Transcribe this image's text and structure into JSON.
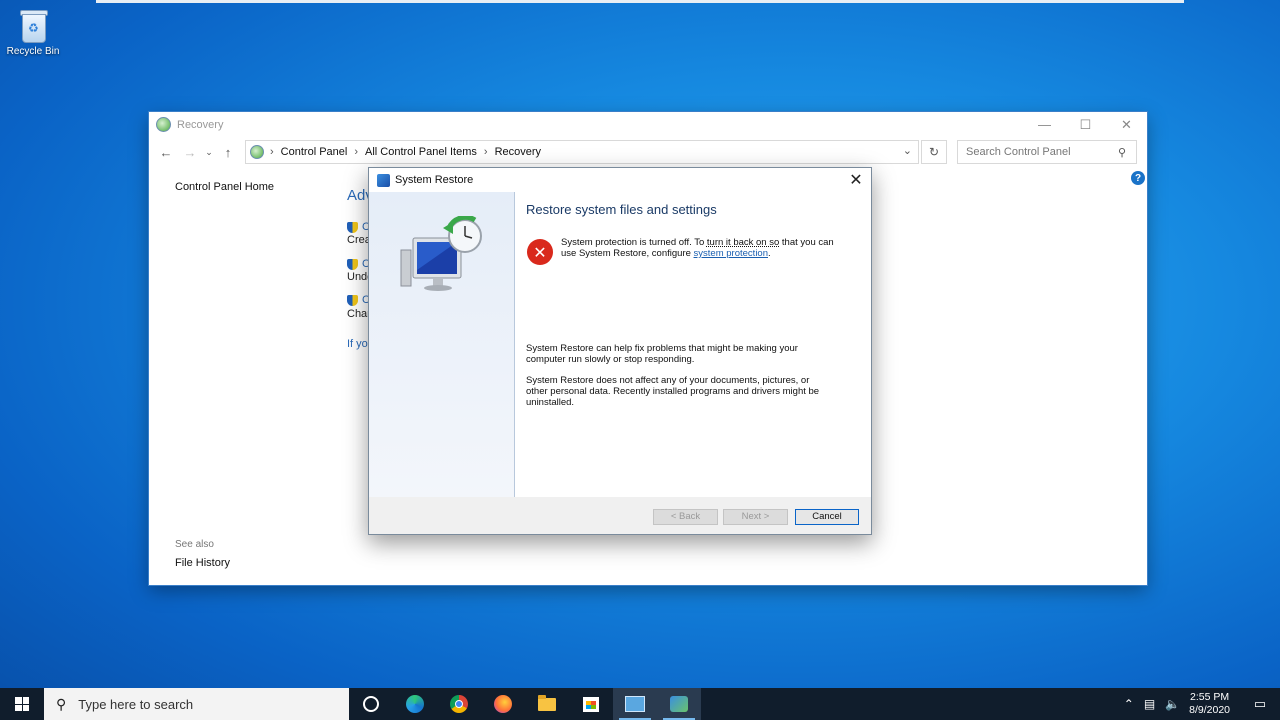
{
  "desktop": {
    "recycle_bin_label": "Recycle Bin"
  },
  "control_panel": {
    "title": "Recovery",
    "breadcrumb": [
      "Control Panel",
      "All Control Panel Items",
      "Recovery"
    ],
    "search_placeholder": "Search Control Panel",
    "left_nav": {
      "home": "Control Panel Home",
      "see_also": "See also",
      "file_history": "File History"
    },
    "obscured": {
      "heading": "Adv",
      "link1": "C",
      "desc1": "Crea",
      "link2": "C",
      "desc2": "Undo",
      "link3": "C",
      "desc3": "Chan",
      "footer": "If yo"
    }
  },
  "system_restore": {
    "title": "System Restore",
    "heading": "Restore system files and settings",
    "error_pre": "System protection is turned off. To ",
    "error_dotted": "turn it back on so",
    "error_mid": " that you can use System Restore, configure ",
    "error_link": "system protection",
    "error_post": ".",
    "para1": "System Restore can help fix problems that might be making your computer run slowly or stop responding.",
    "para2": "System Restore does not affect any of your documents, pictures, or other personal data. Recently installed programs and drivers might be uninstalled.",
    "buttons": {
      "back": "< Back",
      "next": "Next >",
      "cancel": "Cancel"
    }
  },
  "taskbar": {
    "search_placeholder": "Type here to search",
    "time": "2:55 PM",
    "date": "8/9/2020",
    "apps": [
      "cortana-icon",
      "edge-icon",
      "chrome-icon",
      "firefox-icon",
      "file-explorer-icon",
      "store-icon",
      "control-panel-icon",
      "system-restore-icon"
    ]
  },
  "colors": {
    "desktop_blue": "#0a63c6",
    "taskbar": "#101d2c",
    "link": "#1a5fb0",
    "error_red": "#d9291c"
  }
}
